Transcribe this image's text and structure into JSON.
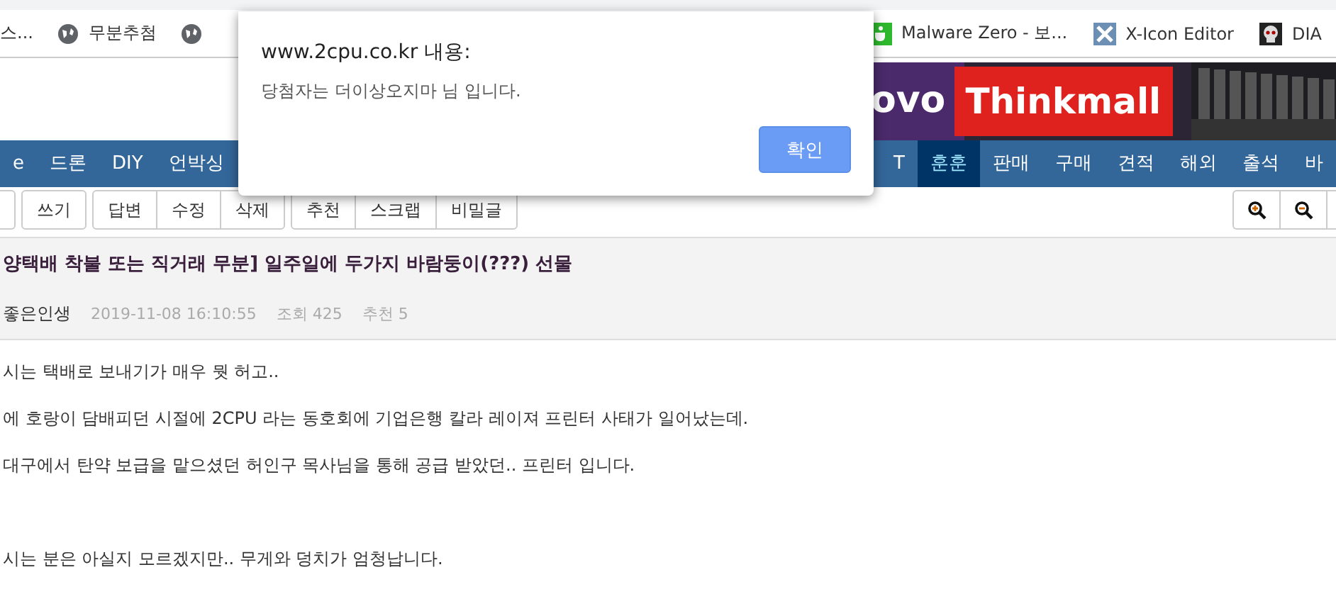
{
  "bookmarks_left": [
    {
      "kind": "plain",
      "label": "스..."
    },
    {
      "kind": "globe",
      "label": "무분추첨"
    },
    {
      "kind": "globe"
    }
  ],
  "bookmarks_right": [
    {
      "kind": "cup",
      "label": "Malware Zero - 보..."
    },
    {
      "kind": "x",
      "label": "X-Icon Editor"
    },
    {
      "kind": "skull",
      "label": "DIA"
    }
  ],
  "banner": {
    "brand": "ovo",
    "store": "Thinkmall"
  },
  "nav": {
    "left": [
      {
        "label": "e",
        "selected": false
      },
      {
        "label": "드론",
        "selected": false
      },
      {
        "label": "DIY",
        "selected": false
      },
      {
        "label": "언박싱",
        "selected": false
      }
    ],
    "right": [
      {
        "label": "T",
        "selected": false
      },
      {
        "label": "훈훈",
        "selected": true
      },
      {
        "label": "판매",
        "selected": false
      },
      {
        "label": "구매",
        "selected": false
      },
      {
        "label": "견적",
        "selected": false
      },
      {
        "label": "해외",
        "selected": false
      },
      {
        "label": "출석",
        "selected": false
      },
      {
        "label": "바",
        "selected": false
      }
    ]
  },
  "toolbar": {
    "groups": [
      [
        "쓰기"
      ],
      [
        "답변",
        "수정",
        "삭제"
      ],
      [
        "추천",
        "스크랩",
        "비밀글"
      ]
    ],
    "tools": [
      {
        "kind": "zoom-in"
      },
      {
        "kind": "zoom-out"
      },
      {
        "kind": "stub"
      }
    ]
  },
  "post": {
    "title": "양택배 착불 또는 직거래 무분] 일주일에 두가지 바람둥이(???) 선물",
    "author": "좋은인생",
    "date": "2019-11-08 16:10:55",
    "views": "조회 425",
    "likes": "추천 5"
  },
  "body": [
    {
      "kind": "line",
      "text": "시는 택배로 보내기가 매우 뭣 허고.."
    },
    {
      "kind": "line",
      "text": "에 호랑이 담배피던 시절에 2CPU 라는 동호회에 기업은행 칼라 레이져 프린터 사태가 일어났는데."
    },
    {
      "kind": "line",
      "text": "대구에서 탄약 보급을 맡으셨던 허인구 목사님을 통해 공급 받았던.. 프린터 입니다."
    },
    {
      "kind": "after-blank",
      "text": "시는 분은 아실지 모르겠지만.. 무게와 덩치가 엄청납니다."
    }
  ],
  "dialog": {
    "title": "www.2cpu.co.kr 내용:",
    "message": "당첨자는 더이상오지마 님 입니다.",
    "button": "확인"
  }
}
